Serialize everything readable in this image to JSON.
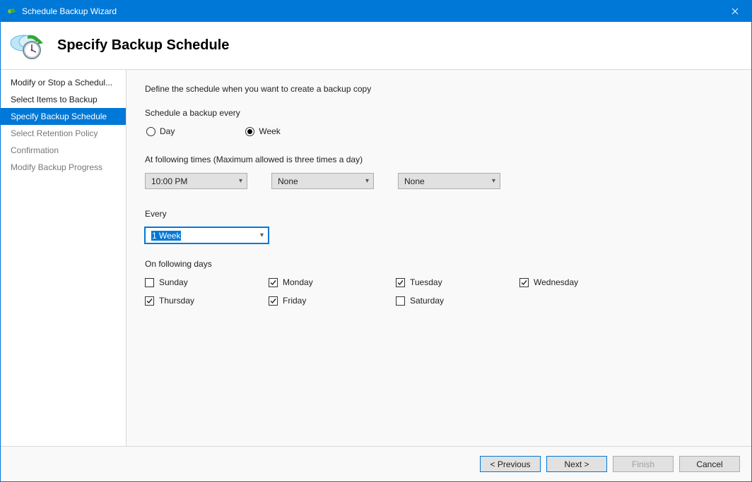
{
  "window": {
    "title": "Schedule Backup Wizard"
  },
  "header": {
    "title": "Specify Backup Schedule"
  },
  "sidebar": {
    "items": [
      {
        "label": "Modify or Stop a Schedul...",
        "state": "normal"
      },
      {
        "label": "Select Items to Backup",
        "state": "normal"
      },
      {
        "label": "Specify Backup Schedule",
        "state": "active"
      },
      {
        "label": "Select Retention Policy",
        "state": "disabled"
      },
      {
        "label": "Confirmation",
        "state": "disabled"
      },
      {
        "label": "Modify Backup Progress",
        "state": "disabled"
      }
    ]
  },
  "content": {
    "instruction": "Define the schedule when you want to create a backup copy",
    "schedule_every_label": "Schedule a backup every",
    "radios": {
      "day": {
        "label": "Day",
        "selected": false
      },
      "week": {
        "label": "Week",
        "selected": true
      }
    },
    "times_label": "At following times (Maximum allowed is three times a day)",
    "times": {
      "t1": "10:00 PM",
      "t2": "None",
      "t3": "None"
    },
    "every_label": "Every",
    "every_value": "1 Week",
    "days_label": "On following days",
    "days": {
      "sunday": {
        "label": "Sunday",
        "checked": false
      },
      "monday": {
        "label": "Monday",
        "checked": true
      },
      "tuesday": {
        "label": "Tuesday",
        "checked": true
      },
      "wednesday": {
        "label": "Wednesday",
        "checked": true
      },
      "thursday": {
        "label": "Thursday",
        "checked": true
      },
      "friday": {
        "label": "Friday",
        "checked": true
      },
      "saturday": {
        "label": "Saturday",
        "checked": false
      }
    }
  },
  "footer": {
    "previous": "< Previous",
    "next": "Next >",
    "finish": "Finish",
    "cancel": "Cancel"
  }
}
